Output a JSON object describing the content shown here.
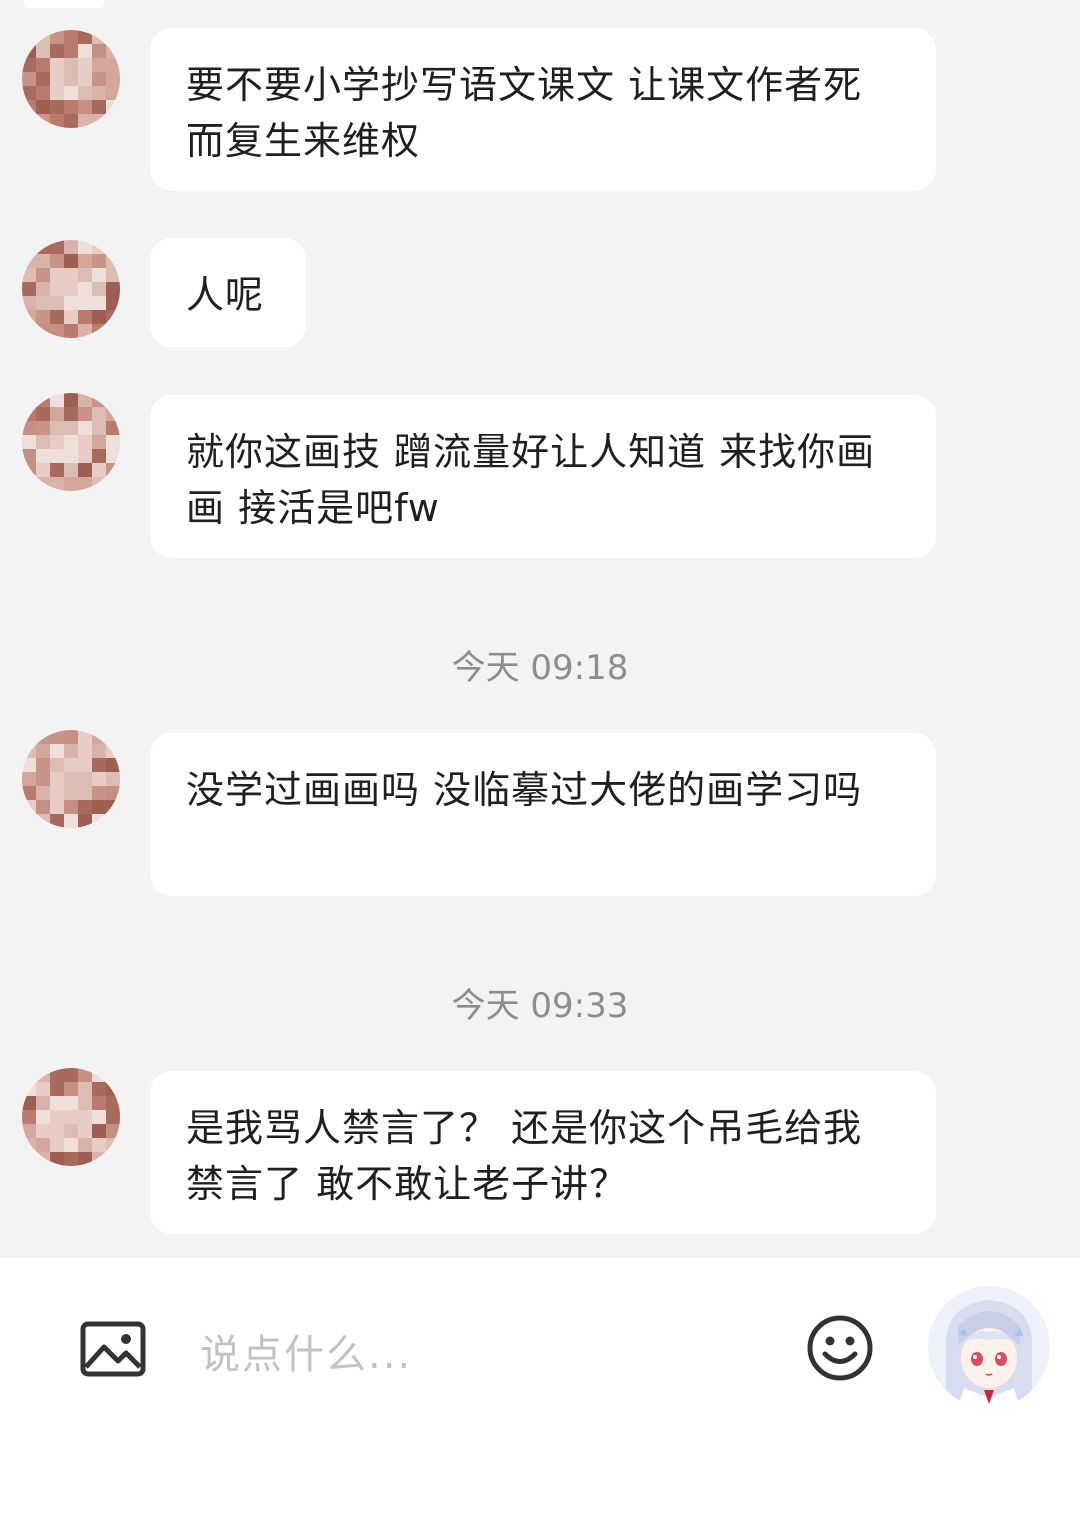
{
  "messages": [
    {
      "text": "要不要小学抄写语文课文 让课文作者死而复生来维权"
    },
    {
      "text": "人呢"
    },
    {
      "text": "就你这画技 蹭流量好让人知道 来找你画画 接活是吧fw"
    },
    {
      "text": "没学过画画吗 没临摹过大佬的画学习吗"
    },
    {
      "text": "是我骂人禁言了？ 还是你这个吊毛给我禁言了 敢不敢让老子讲？"
    }
  ],
  "timestamps": [
    "今天 09:18",
    "今天 09:33"
  ],
  "input": {
    "placeholder": "说点什么..."
  },
  "icons": {
    "image": "image-icon",
    "emoji": "smiley-icon"
  }
}
